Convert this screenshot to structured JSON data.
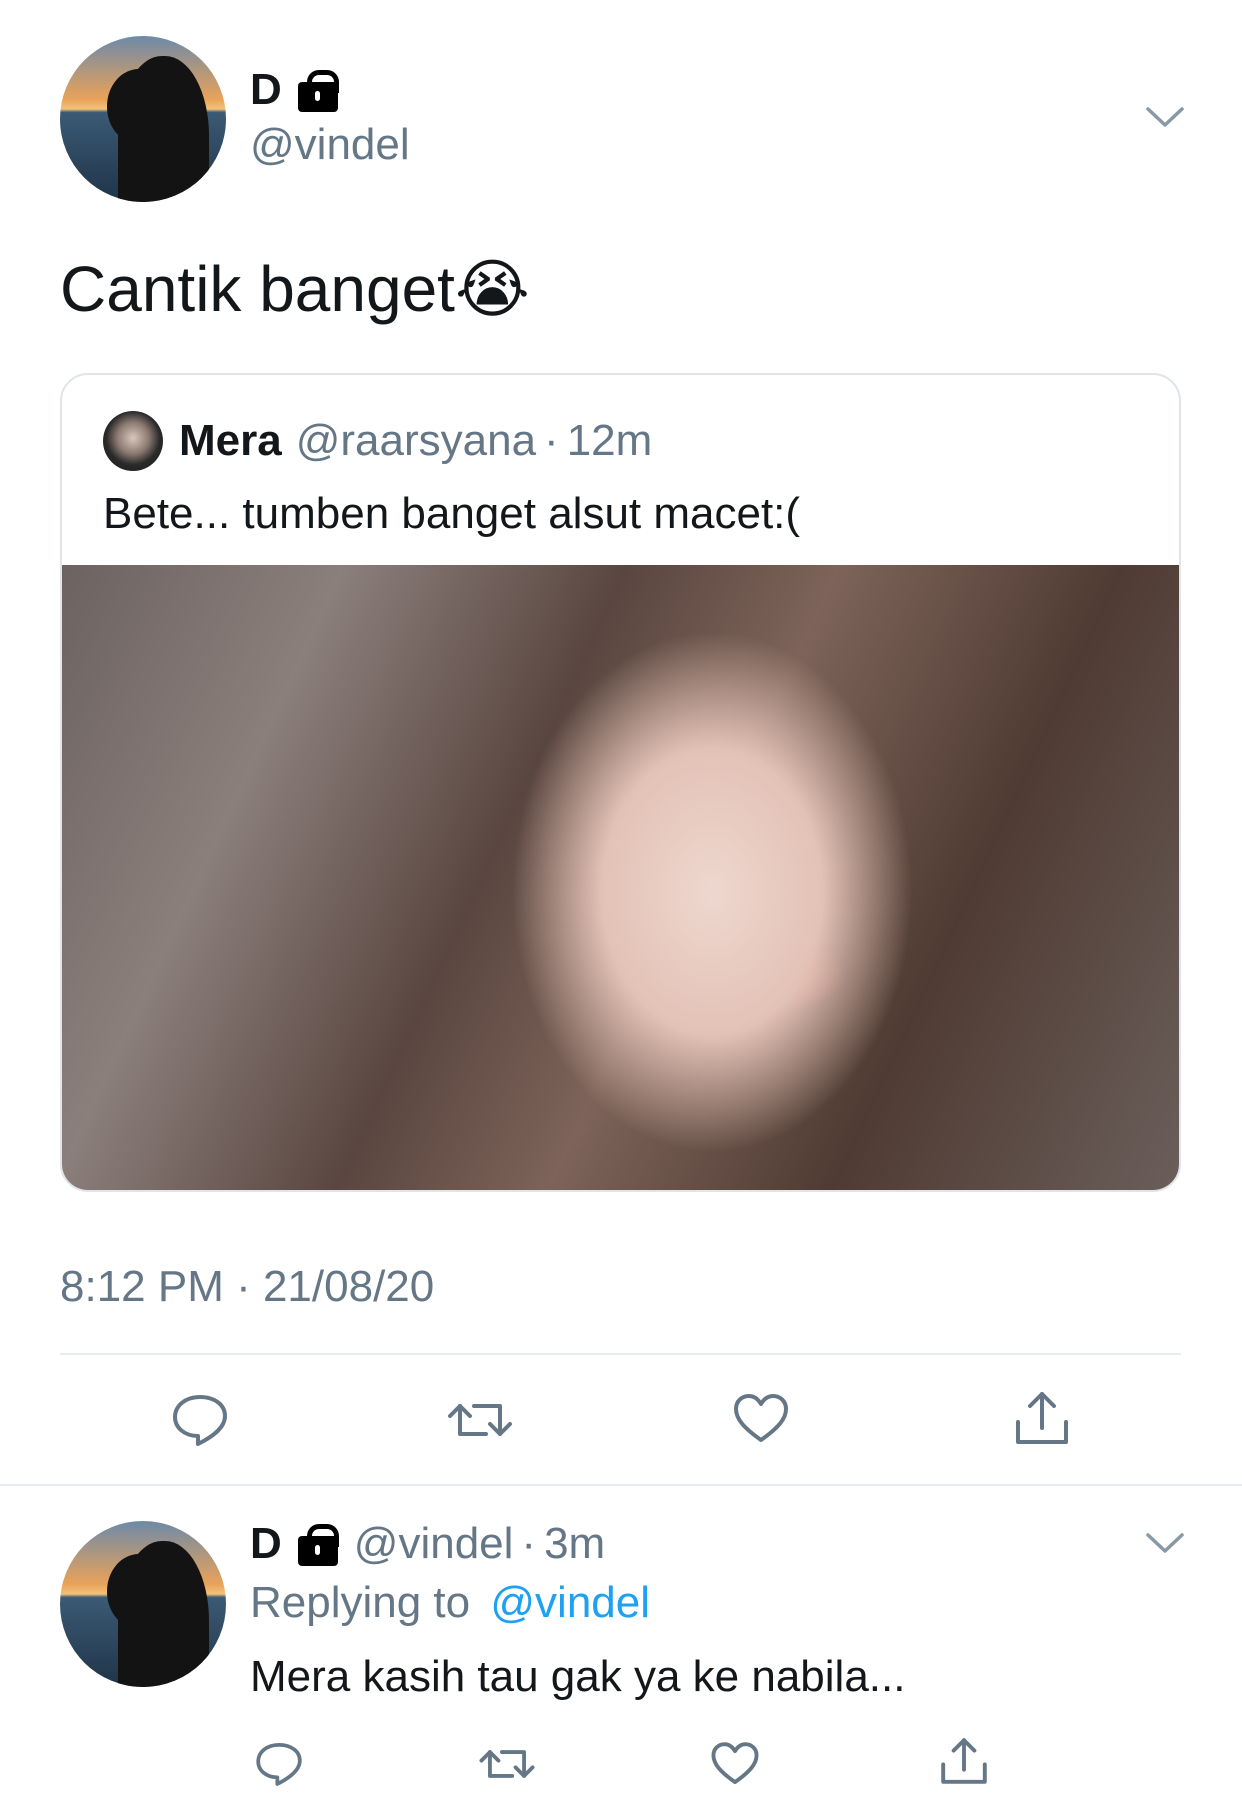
{
  "tweet": {
    "author_name": "D",
    "author_handle": "@vindel",
    "protected_icon": "lock-icon",
    "text": "Cantik banget😭",
    "timestamp": "8:12 PM · 21/08/20",
    "quoted": {
      "author_name": "Mera",
      "author_handle": "@raarsyana",
      "separator": "·",
      "age": "12m",
      "text": "Bete... tumben banget alsut macet:("
    }
  },
  "reply": {
    "author_name": "D",
    "author_handle": "@vindel",
    "separator": "·",
    "age": "3m",
    "replying_prefix": "Replying to",
    "replying_handle": "@vindel",
    "text": "Mera kasih tau gak ya ke nabila..."
  },
  "actions": [
    "reply-icon",
    "retweet-icon",
    "like-icon",
    "share-icon"
  ],
  "colors": {
    "text": "#14171a",
    "muted": "#657786",
    "link": "#1da1f2",
    "divider": "#e6ecf0",
    "icon": "#657786"
  }
}
